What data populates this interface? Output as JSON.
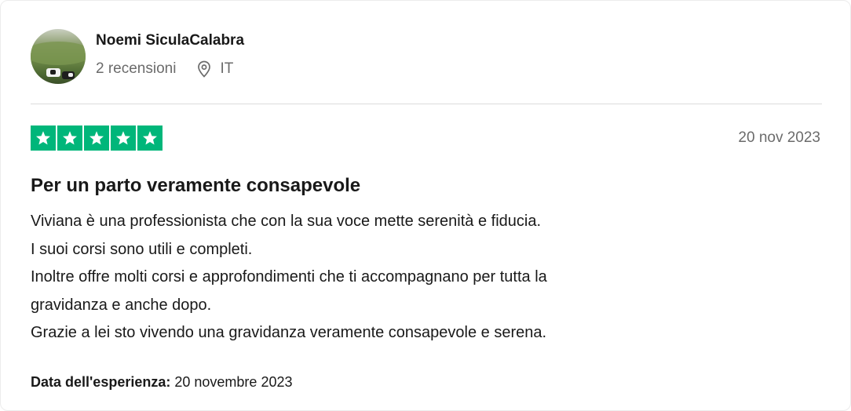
{
  "reviewer": {
    "name": "Noemi SiculaCalabra",
    "reviews_count": "2 recensioni",
    "country": "IT",
    "avatar_icon": "avatar-photo-landscape-cows",
    "location_icon": "location-pin-icon"
  },
  "review": {
    "rating": 5,
    "rating_max": 5,
    "star_color": "#00b67a",
    "date": "20 nov 2023",
    "title": "Per un parto veramente consapevole",
    "body_lines": [
      "Viviana è una professionista che con la sua voce mette serenità e fiducia.",
      "I suoi corsi sono utili e completi.",
      "Inoltre offre molti corsi e approfondimenti che ti accompagnano per tutta la",
      "gravidanza e anche dopo.",
      "Grazie a lei sto vivendo una gravidanza veramente consapevole e serena."
    ],
    "experience_label": "Data dell'esperienza:",
    "experience_date": "20 novembre 2023"
  }
}
